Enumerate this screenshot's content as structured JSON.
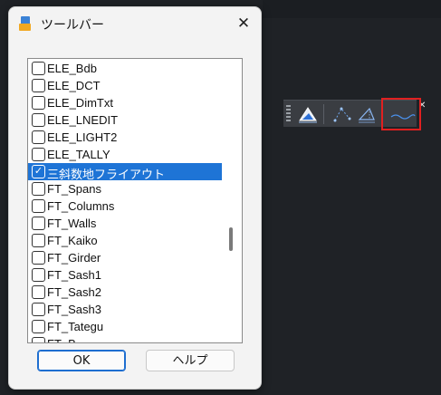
{
  "dialog": {
    "title": "ツールバー",
    "close_glyph": "✕",
    "items": [
      {
        "label": "ELE_Bdb",
        "checked": false,
        "selected": false
      },
      {
        "label": "ELE_DCT",
        "checked": false,
        "selected": false
      },
      {
        "label": "ELE_DimTxt",
        "checked": false,
        "selected": false
      },
      {
        "label": "ELE_LNEDIT",
        "checked": false,
        "selected": false
      },
      {
        "label": "ELE_LIGHT2",
        "checked": false,
        "selected": false
      },
      {
        "label": "ELE_TALLY",
        "checked": false,
        "selected": false
      },
      {
        "label": "三斜数地フライアウト",
        "checked": true,
        "selected": true
      },
      {
        "label": "FT_Spans",
        "checked": false,
        "selected": false
      },
      {
        "label": "FT_Columns",
        "checked": false,
        "selected": false
      },
      {
        "label": "FT_Walls",
        "checked": false,
        "selected": false
      },
      {
        "label": "FT_Kaiko",
        "checked": false,
        "selected": false
      },
      {
        "label": "FT_Girder",
        "checked": false,
        "selected": false
      },
      {
        "label": "FT_Sash1",
        "checked": false,
        "selected": false
      },
      {
        "label": "FT_Sash2",
        "checked": false,
        "selected": false
      },
      {
        "label": "FT_Sash3",
        "checked": false,
        "selected": false
      },
      {
        "label": "FT_Tategu",
        "checked": false,
        "selected": false
      },
      {
        "label": "FT_B",
        "checked": false,
        "selected": false
      }
    ],
    "ok_label": "OK",
    "help_label": "ヘルプ"
  },
  "toolbar": {
    "close_glyph": "✕",
    "buttons": [
      "triangle-land-icon",
      "dotted-triangle-icon",
      "triangle-dimension-icon",
      "wave-line-icon"
    ]
  },
  "colors": {
    "selection": "#1e74d6",
    "highlight": "#e02020",
    "background": "#1f2226"
  }
}
